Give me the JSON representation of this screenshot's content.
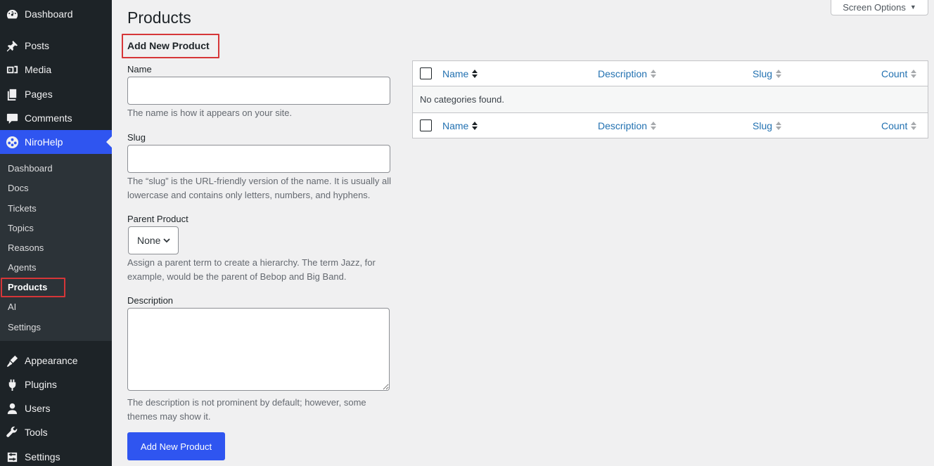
{
  "sidebar": {
    "top_items": [
      {
        "label": "Dashboard",
        "icon": "dashboard-icon"
      },
      {
        "label": "Posts",
        "icon": "pin-icon"
      },
      {
        "label": "Media",
        "icon": "media-icon"
      },
      {
        "label": "Pages",
        "icon": "pages-icon"
      },
      {
        "label": "Comments",
        "icon": "comment-icon"
      }
    ],
    "active_item": {
      "label": "NiroHelp",
      "icon": "nirohelp-icon"
    },
    "submenu": [
      "Dashboard",
      "Docs",
      "Tickets",
      "Topics",
      "Reasons",
      "Agents",
      "Products",
      "AI",
      "Settings"
    ],
    "bottom_items": [
      {
        "label": "Appearance",
        "icon": "brush-icon"
      },
      {
        "label": "Plugins",
        "icon": "plugin-icon"
      },
      {
        "label": "Users",
        "icon": "user-icon"
      },
      {
        "label": "Tools",
        "icon": "wrench-icon"
      },
      {
        "label": "Settings",
        "icon": "settings-icon"
      }
    ]
  },
  "header": {
    "screen_options": "Screen Options",
    "title": "Products"
  },
  "form": {
    "heading": "Add New Product",
    "name_label": "Name",
    "name_value": "",
    "name_help": "The name is how it appears on your site.",
    "slug_label": "Slug",
    "slug_value": "",
    "slug_help": "The “slug” is the URL-friendly version of the name. It is usually all lowercase and contains only letters, numbers, and hyphens.",
    "parent_label": "Parent Product",
    "parent_value": "None",
    "parent_help": "Assign a parent term to create a hierarchy. The term Jazz, for example, would be the parent of Bebop and Big Band.",
    "description_label": "Description",
    "description_value": "",
    "description_help": "The description is not prominent by default; however, some themes may show it.",
    "submit_label": "Add New Product"
  },
  "table": {
    "columns": [
      "Name",
      "Description",
      "Slug",
      "Count"
    ],
    "empty_message": "No categories found."
  },
  "colors": {
    "accent": "#2f55f0",
    "sidebar_bg": "#1d2327",
    "submenu_bg": "#2c3338",
    "highlight_box": "#d63638",
    "link": "#2271b1"
  }
}
